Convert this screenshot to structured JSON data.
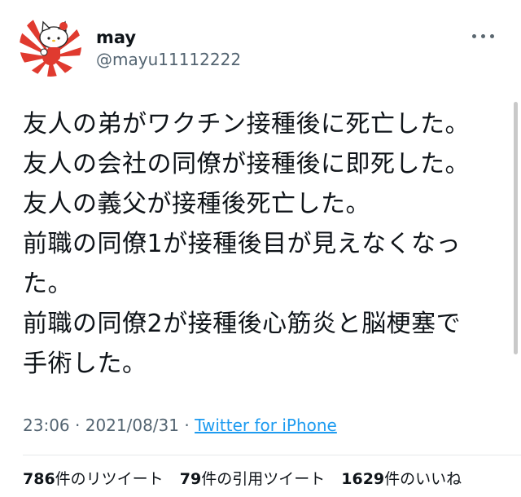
{
  "user": {
    "name": "may",
    "handle": "@mayu11112222",
    "avatar_icon": "hello-kitty-avatar-icon"
  },
  "tweet": {
    "lines": [
      "友人の弟がワクチン接種後に死亡した。",
      "友人の会社の同僚が接種後に即死した。",
      "友人の義父が接種後死亡した。",
      "前職の同僚1が接種後目が見えなくなっ",
      "た。",
      "前職の同僚2が接種後心筋炎と脳梗塞で",
      "手術した。"
    ]
  },
  "meta": {
    "time": "23:06",
    "separator1": " · ",
    "date": "2021/08/31",
    "separator2": " · ",
    "source": "Twitter for iPhone"
  },
  "stats": {
    "retweets_count": "786",
    "retweets_label": "件のリツイート",
    "quotes_count": "79",
    "quotes_label": "件の引用ツイート",
    "likes_count": "1629",
    "likes_label": "件のいいね"
  },
  "colors": {
    "accent": "#1d9bf0",
    "secondary_text": "#536471",
    "avatar_red": "#e03a2f"
  }
}
